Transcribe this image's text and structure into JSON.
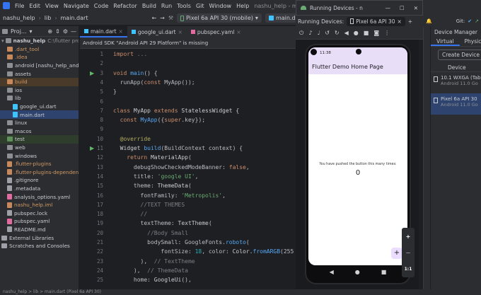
{
  "menu": [
    "File",
    "Edit",
    "View",
    "Navigate",
    "Code",
    "Refactor",
    "Build",
    "Run",
    "Tools",
    "Git",
    "Window",
    "Help"
  ],
  "window_title": "nashu_help - main.dart [nashu_",
  "toolbar": {
    "crumbs": [
      "nashu_help",
      "lib",
      "main.dart"
    ],
    "device_select": "Pixel 6a API 30 (mobile)",
    "config_select": "main.dart",
    "git_label": "Git:"
  },
  "project": {
    "head": "Proj...",
    "root": "nashu_help",
    "root_path": "C:\\flutter projects\\n",
    "items": [
      {
        "label": ".dart_tool",
        "kind": "folder-orange",
        "indent": 1
      },
      {
        "label": ".idea",
        "kind": "folder-orange",
        "indent": 1
      },
      {
        "label": "android [nashu_help_androi",
        "kind": "folder",
        "indent": 1
      },
      {
        "label": "assets",
        "kind": "folder",
        "indent": 1
      },
      {
        "label": "build",
        "kind": "folder-orange",
        "indent": 1
      },
      {
        "label": "ios",
        "kind": "folder",
        "indent": 1
      },
      {
        "label": "lib",
        "kind": "folder",
        "indent": 1
      },
      {
        "label": "google_ui.dart",
        "kind": "dart",
        "indent": 2
      },
      {
        "label": "main.dart",
        "kind": "dart",
        "indent": 2
      },
      {
        "label": "linux",
        "kind": "folder",
        "indent": 1
      },
      {
        "label": "macos",
        "kind": "folder",
        "indent": 1
      },
      {
        "label": "test",
        "kind": "folder-green",
        "indent": 1
      },
      {
        "label": "web",
        "kind": "folder",
        "indent": 1
      },
      {
        "label": "windows",
        "kind": "folder",
        "indent": 1
      },
      {
        "label": ".flutter-plugins",
        "kind": "file-orange",
        "indent": 1
      },
      {
        "label": ".flutter-plugins-dependencie",
        "kind": "file-orange",
        "indent": 1
      },
      {
        "label": ".gitignore",
        "kind": "file",
        "indent": 1
      },
      {
        "label": ".metadata",
        "kind": "file",
        "indent": 1
      },
      {
        "label": "analysis_options.yaml",
        "kind": "yaml",
        "indent": 1
      },
      {
        "label": "nashu_help.iml",
        "kind": "file-orange",
        "indent": 1
      },
      {
        "label": "pubspec.lock",
        "kind": "file",
        "indent": 1
      },
      {
        "label": "pubspec.yaml",
        "kind": "yaml",
        "indent": 1
      },
      {
        "label": "README.md",
        "kind": "file",
        "indent": 1
      },
      {
        "label": "External Libraries",
        "kind": "lib",
        "indent": 0
      },
      {
        "label": "Scratches and Consoles",
        "kind": "scratch",
        "indent": 0
      }
    ]
  },
  "editor": {
    "tabs": [
      "main.dart",
      "google_ui.dart",
      "pubspec.yaml"
    ],
    "warning": "Android SDK \"Android API 29 Platform\" is missing",
    "lines": [
      {
        "n": "1",
        "tokens": [
          [
            "kw",
            "import "
          ],
          [
            "cm",
            "..."
          ]
        ]
      },
      {
        "n": "2",
        "tokens": []
      },
      {
        "n": "3",
        "tokens": [
          [
            "kw",
            "void "
          ],
          [
            "fn",
            "main"
          ],
          [
            "prm",
            "() {"
          ]
        ]
      },
      {
        "n": "4",
        "tokens": [
          [
            "prm",
            "  runApp("
          ],
          [
            "kw",
            "const "
          ],
          [
            "prm",
            "MyApp());"
          ]
        ]
      },
      {
        "n": "5",
        "tokens": [
          [
            "prm",
            "}"
          ]
        ]
      },
      {
        "n": "6",
        "tokens": []
      },
      {
        "n": "7",
        "tokens": [
          [
            "kw",
            "class "
          ],
          [
            "cls",
            "MyApp "
          ],
          [
            "kw",
            "extends "
          ],
          [
            "cls",
            "StatelessWidget {"
          ]
        ]
      },
      {
        "n": "8",
        "tokens": [
          [
            "kw",
            "  const "
          ],
          [
            "fn",
            "MyApp"
          ],
          [
            "prm",
            "({"
          ],
          [
            "kw",
            "super"
          ],
          [
            "prm",
            ".key});"
          ]
        ]
      },
      {
        "n": "9",
        "tokens": []
      },
      {
        "n": "10",
        "tokens": [
          [
            "an",
            "  @override"
          ]
        ]
      },
      {
        "n": "11",
        "tokens": [
          [
            "cls",
            "  Widget "
          ],
          [
            "fn",
            "build"
          ],
          [
            "prm",
            "(BuildContext context) {"
          ]
        ]
      },
      {
        "n": "12",
        "tokens": [
          [
            "kw",
            "    return "
          ],
          [
            "cls",
            "MaterialApp"
          ],
          [
            "prm",
            "("
          ]
        ]
      },
      {
        "n": "13",
        "tokens": [
          [
            "prm",
            "      debugShowCheckedModeBanner: "
          ],
          [
            "kw",
            "false"
          ],
          [
            "prm",
            ","
          ]
        ]
      },
      {
        "n": "14",
        "tokens": [
          [
            "prm",
            "      title: "
          ],
          [
            "str",
            "'google UI'"
          ],
          [
            "prm",
            ","
          ]
        ]
      },
      {
        "n": "15",
        "tokens": [
          [
            "prm",
            "      theme: "
          ],
          [
            "cls",
            "ThemeData"
          ],
          [
            "prm",
            "("
          ]
        ]
      },
      {
        "n": "16",
        "tokens": [
          [
            "prm",
            "        fontFamily: "
          ],
          [
            "str",
            "'Metropolis'"
          ],
          [
            "prm",
            ","
          ]
        ]
      },
      {
        "n": "17",
        "tokens": [
          [
            "cm",
            "        //TEXT THEMES"
          ]
        ]
      },
      {
        "n": "18",
        "tokens": [
          [
            "cm",
            "        //"
          ]
        ]
      },
      {
        "n": "19",
        "tokens": [
          [
            "prm",
            "        textTheme: "
          ],
          [
            "cls",
            "TextTheme"
          ],
          [
            "prm",
            "("
          ]
        ]
      },
      {
        "n": "20",
        "tokens": [
          [
            "cm",
            "          //Body Small"
          ]
        ]
      },
      {
        "n": "21",
        "tokens": [
          [
            "prm",
            "          bodySmall: GoogleFonts."
          ],
          [
            "fn",
            "roboto"
          ],
          [
            "prm",
            "("
          ]
        ]
      },
      {
        "n": "22",
        "tokens": [
          [
            "prm",
            "              fontSize: "
          ],
          [
            "num",
            "18"
          ],
          [
            "prm",
            ", color: "
          ],
          [
            "cls",
            "Color."
          ],
          [
            "fn",
            "fromARGB"
          ],
          [
            "prm",
            "(255"
          ]
        ]
      },
      {
        "n": "23",
        "tokens": [
          [
            "prm",
            "        ),  "
          ],
          [
            "cm",
            "// TextTheme"
          ]
        ]
      },
      {
        "n": "24",
        "tokens": [
          [
            "prm",
            "      ),  "
          ],
          [
            "cm",
            "// ThemeData"
          ]
        ]
      },
      {
        "n": "25",
        "tokens": [
          [
            "prm",
            "      home: "
          ],
          [
            "cls",
            "GoogleUi"
          ],
          [
            "prm",
            "(),"
          ]
        ]
      }
    ]
  },
  "running_devices": {
    "title": "Running Devices - n",
    "tab_label": "Running Devices:",
    "device_tab": "Pixel 6a API 30",
    "phone": {
      "time": "11:38",
      "app_title": "Flutter Demo Home Page",
      "message": "You have pushed the button this many times:",
      "counter": "0",
      "fab": "+",
      "zoom_in": "+",
      "zoom_out": "—",
      "zoom_ratio": "1:1"
    }
  },
  "device_manager": {
    "title": "Device Manager",
    "tabs": [
      "Virtual",
      "Physica"
    ],
    "create_button": "Create Device",
    "column": "Device",
    "devices": [
      {
        "name": "10.1  WXGA (Tab",
        "sub": "Android 11.0 Go"
      },
      {
        "name": "Pixel 6a API 30",
        "sub": "Android 11.0 Go"
      }
    ]
  },
  "statusbar": "nashu_help > lib > main.dart (Pixel 6a API 30)"
}
